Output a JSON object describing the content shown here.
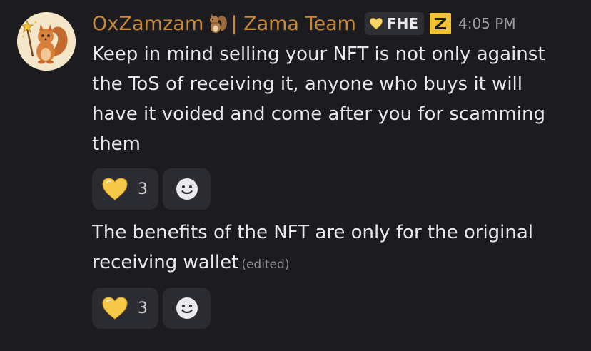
{
  "message": {
    "author": {
      "name": "OxZamzam",
      "name_suffix": "| Zama Team",
      "avatar_icon": "squirrel-wizard-avatar",
      "name_color": "#c58a3a"
    },
    "role_tag": {
      "icon": "yellow-heart-icon",
      "label": "FHE"
    },
    "badge": {
      "letter": "Z",
      "color": "#f2c232"
    },
    "timestamp": "4:05 PM",
    "posts": [
      {
        "lines": [
          "Keep in mind selling your NFT is not only against",
          "the ToS of receiving it, anyone who buys it will",
          "have it voided and come after you for scamming",
          "them"
        ],
        "reactions": [
          {
            "emoji": "yellow-heart-icon",
            "count": "3"
          }
        ]
      },
      {
        "lines": [
          "The benefits of the NFT are only for the original",
          "receiving wallet"
        ],
        "edited_label": "(edited)",
        "reactions": [
          {
            "emoji": "yellow-heart-icon",
            "count": "3"
          }
        ]
      }
    ]
  }
}
